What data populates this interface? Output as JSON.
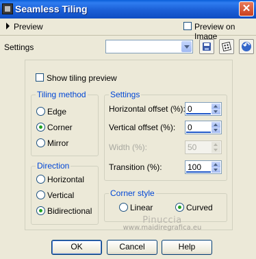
{
  "window": {
    "title": "Seamless Tiling",
    "close_glyph": "✕"
  },
  "preview": {
    "label": "Preview",
    "on_image_label": "Preview on Image",
    "on_image_checked": false
  },
  "settings_row": {
    "label": "Settings",
    "preset_value": ""
  },
  "show_tiling_preview": {
    "label": "Show tiling preview",
    "checked": false
  },
  "tiling_method": {
    "title": "Tiling method",
    "options": [
      {
        "label": "Edge",
        "selected": false
      },
      {
        "label": "Corner",
        "selected": true
      },
      {
        "label": "Mirror",
        "selected": false
      }
    ]
  },
  "settings_group": {
    "title": "Settings",
    "horizontal_offset": {
      "label": "Horizontal offset (%):",
      "value": "0"
    },
    "vertical_offset": {
      "label": "Vertical offset (%):",
      "value": "0"
    },
    "width": {
      "label": "Width (%):",
      "value": "50",
      "disabled": true
    },
    "transition": {
      "label": "Transition (%):",
      "value": "100"
    }
  },
  "direction": {
    "title": "Direction",
    "options": [
      {
        "label": "Horizontal",
        "selected": false
      },
      {
        "label": "Vertical",
        "selected": false
      },
      {
        "label": "Bidirectional",
        "selected": true
      }
    ]
  },
  "corner_style": {
    "title": "Corner style",
    "options": [
      {
        "label": "Linear",
        "selected": false
      },
      {
        "label": "Curved",
        "selected": true
      }
    ]
  },
  "watermark": {
    "name": "Pinuccia",
    "url": "www.maidiregrafica.eu"
  },
  "buttons": {
    "ok": "OK",
    "cancel": "Cancel",
    "help": "Help"
  },
  "icons": [
    "app-icon",
    "close-icon",
    "expand-arrow-icon",
    "dropdown-arrow-icon",
    "save-preset-icon",
    "randomize-dice-icon",
    "reset-icon",
    "spin-up-icon",
    "spin-down-icon"
  ],
  "colors": {
    "title_bar": "#0a5fd8",
    "dialog_bg": "#ece9d8",
    "group_title": "#0046d5",
    "radio_dot": "#21a121"
  }
}
